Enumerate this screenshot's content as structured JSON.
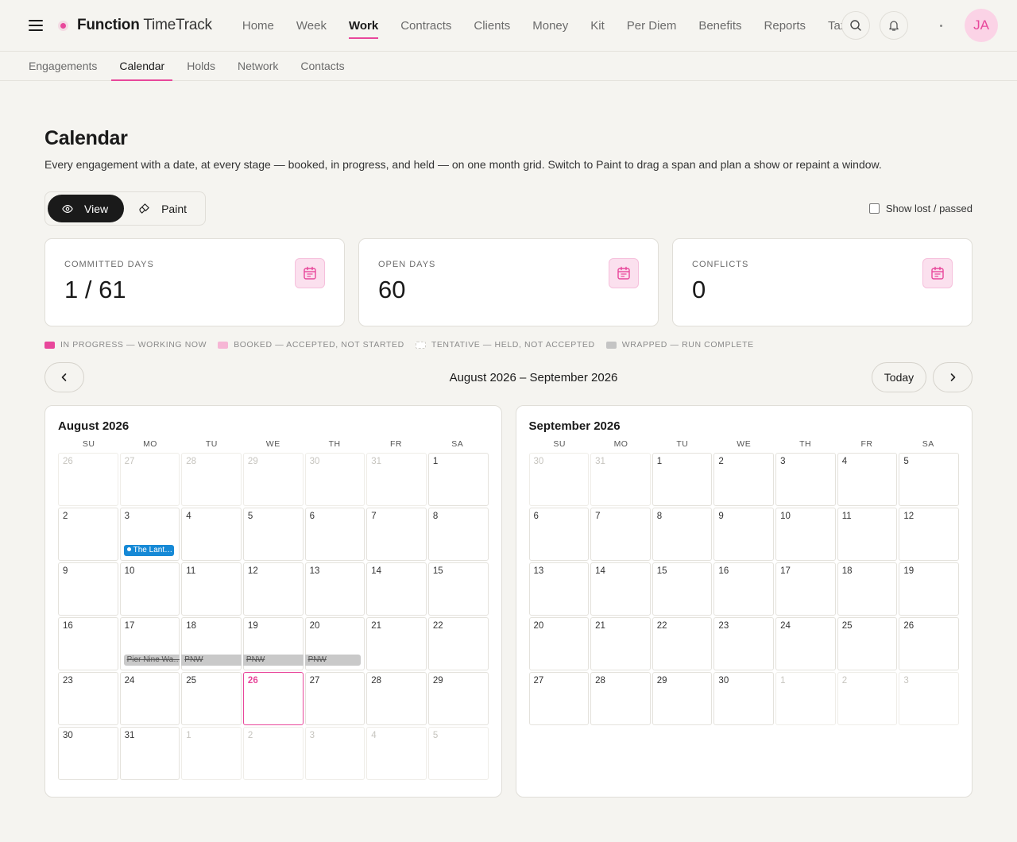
{
  "app": {
    "brand_bold": "Function",
    "brand_rest": " TimeTrack",
    "avatar": "JA"
  },
  "topnav": [
    {
      "label": "Home"
    },
    {
      "label": "Week"
    },
    {
      "label": "Work",
      "active": true
    },
    {
      "label": "Contracts"
    },
    {
      "label": "Clients"
    },
    {
      "label": "Money"
    },
    {
      "label": "Kit"
    },
    {
      "label": "Per Diem"
    },
    {
      "label": "Benefits"
    },
    {
      "label": "Reports"
    },
    {
      "label": "Tax"
    }
  ],
  "subnav": [
    {
      "label": "Engagements"
    },
    {
      "label": "Calendar",
      "active": true
    },
    {
      "label": "Holds"
    },
    {
      "label": "Network"
    },
    {
      "label": "Contacts"
    }
  ],
  "page": {
    "title": "Calendar",
    "description": "Every engagement with a date, at every stage — booked, in progress, and held — on one month grid. Switch to Paint to drag a span and plan a show or repaint a window."
  },
  "mode": {
    "view": "View",
    "paint": "Paint",
    "selected": "View"
  },
  "show_lost": {
    "label": "Show lost / passed",
    "checked": false
  },
  "stats": [
    {
      "label": "COMMITTED DAYS",
      "value": "1 / 61"
    },
    {
      "label": "OPEN DAYS",
      "value": "60"
    },
    {
      "label": "CONFLICTS",
      "value": "0"
    }
  ],
  "legend": [
    {
      "label": "IN PROGRESS — WORKING NOW",
      "color": "#e8479b"
    },
    {
      "label": "BOOKED — ACCEPTED, NOT STARTED",
      "color": "#f6b6d5"
    },
    {
      "label": "TENTATIVE — HELD, NOT ACCEPTED",
      "color": "#ffffff"
    },
    {
      "label": "WRAPPED — RUN COMPLETE",
      "color": "#c4c4c4"
    }
  ],
  "nav": {
    "range": "August 2026 – September 2026",
    "today": "Today"
  },
  "weekdays": [
    "SU",
    "MO",
    "TU",
    "WE",
    "TH",
    "FR",
    "SA"
  ],
  "months": [
    {
      "title": "August 2026",
      "days": [
        {
          "n": "26",
          "out": true
        },
        {
          "n": "27",
          "out": true
        },
        {
          "n": "28",
          "out": true
        },
        {
          "n": "29",
          "out": true
        },
        {
          "n": "30",
          "out": true
        },
        {
          "n": "31",
          "out": true
        },
        {
          "n": "1"
        },
        {
          "n": "2"
        },
        {
          "n": "3",
          "event": {
            "label": "The Lant…",
            "kind": "booked"
          }
        },
        {
          "n": "4"
        },
        {
          "n": "5"
        },
        {
          "n": "6"
        },
        {
          "n": "7"
        },
        {
          "n": "8"
        },
        {
          "n": "9"
        },
        {
          "n": "10"
        },
        {
          "n": "11"
        },
        {
          "n": "12"
        },
        {
          "n": "13"
        },
        {
          "n": "14"
        },
        {
          "n": "15"
        },
        {
          "n": "16"
        },
        {
          "n": "17",
          "event": {
            "label": "Pier Nine Wa…",
            "kind": "wrap",
            "pos": "first"
          }
        },
        {
          "n": "18",
          "event": {
            "label": "PNW",
            "kind": "wrap"
          }
        },
        {
          "n": "19",
          "event": {
            "label": "PNW",
            "kind": "wrap"
          }
        },
        {
          "n": "20",
          "event": {
            "label": "PNW",
            "kind": "wrap",
            "pos": "last"
          }
        },
        {
          "n": "21"
        },
        {
          "n": "22"
        },
        {
          "n": "23"
        },
        {
          "n": "24"
        },
        {
          "n": "25"
        },
        {
          "n": "26",
          "today": true
        },
        {
          "n": "27"
        },
        {
          "n": "28"
        },
        {
          "n": "29"
        },
        {
          "n": "30"
        },
        {
          "n": "31"
        },
        {
          "n": "1",
          "out": true
        },
        {
          "n": "2",
          "out": true
        },
        {
          "n": "3",
          "out": true
        },
        {
          "n": "4",
          "out": true
        },
        {
          "n": "5",
          "out": true
        }
      ]
    },
    {
      "title": "September 2026",
      "days": [
        {
          "n": "30",
          "out": true
        },
        {
          "n": "31",
          "out": true
        },
        {
          "n": "1"
        },
        {
          "n": "2"
        },
        {
          "n": "3"
        },
        {
          "n": "4"
        },
        {
          "n": "5"
        },
        {
          "n": "6"
        },
        {
          "n": "7"
        },
        {
          "n": "8"
        },
        {
          "n": "9"
        },
        {
          "n": "10"
        },
        {
          "n": "11"
        },
        {
          "n": "12"
        },
        {
          "n": "13"
        },
        {
          "n": "14"
        },
        {
          "n": "15"
        },
        {
          "n": "16"
        },
        {
          "n": "17"
        },
        {
          "n": "18"
        },
        {
          "n": "19"
        },
        {
          "n": "20"
        },
        {
          "n": "21"
        },
        {
          "n": "22"
        },
        {
          "n": "23"
        },
        {
          "n": "24"
        },
        {
          "n": "25"
        },
        {
          "n": "26"
        },
        {
          "n": "27"
        },
        {
          "n": "28"
        },
        {
          "n": "29"
        },
        {
          "n": "30"
        },
        {
          "n": "1",
          "out": true
        },
        {
          "n": "2",
          "out": true
        },
        {
          "n": "3",
          "out": true
        }
      ]
    }
  ]
}
